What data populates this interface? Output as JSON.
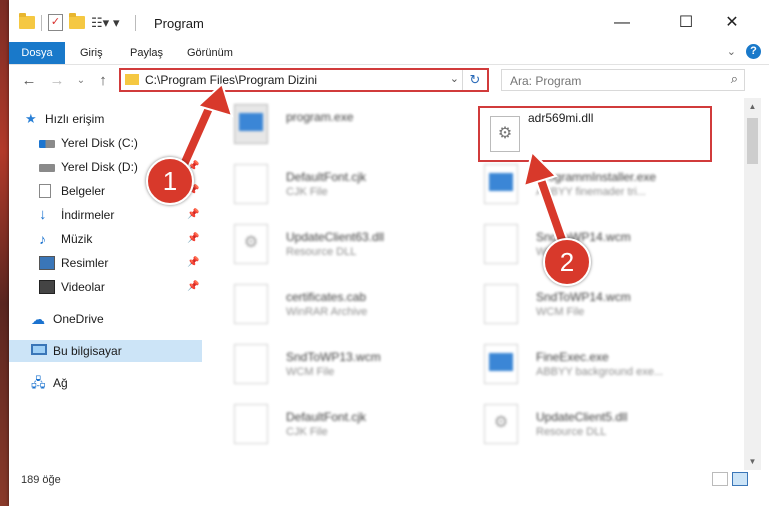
{
  "window": {
    "title": "Program",
    "controls": {
      "minimize": "—",
      "maximize": "☐",
      "close": "✕"
    }
  },
  "ribbon": {
    "tabs": [
      {
        "label": "Dosya"
      },
      {
        "label": "Giriş"
      },
      {
        "label": "Paylaş"
      },
      {
        "label": "Görünüm"
      }
    ],
    "help": "?"
  },
  "navigation": {
    "address_path": "C:\\Program Files\\Program Dizini",
    "search_placeholder": "Ara: Program"
  },
  "sidebar": {
    "items": [
      {
        "label": "Hızlı erişim",
        "icon": "star-icon"
      },
      {
        "label": "Yerel Disk (C:)",
        "icon": "disk-icon",
        "pinned": true
      },
      {
        "label": "Yerel Disk (D:)",
        "icon": "disk-icon",
        "pinned": true
      },
      {
        "label": "Belgeler",
        "icon": "documents-icon",
        "pinned": true
      },
      {
        "label": "İndirmeler",
        "icon": "downloads-icon",
        "pinned": true
      },
      {
        "label": "Müzik",
        "icon": "music-icon",
        "pinned": true
      },
      {
        "label": "Resimler",
        "icon": "pictures-icon",
        "pinned": true
      },
      {
        "label": "Videolar",
        "icon": "videos-icon",
        "pinned": true
      },
      {
        "label": "OneDrive",
        "icon": "cloud-icon"
      },
      {
        "label": "Bu bilgisayar",
        "icon": "computer-icon",
        "selected": true
      },
      {
        "label": "Ağ",
        "icon": "network-icon"
      }
    ]
  },
  "files": {
    "highlighted": {
      "name": "adr569mi.dll"
    },
    "left_column": [
      {
        "name": "program.exe",
        "sub": "",
        "icon": "exe"
      },
      {
        "name": "DefaultFont.cjk",
        "sub": "CJK File",
        "icon": "doc"
      },
      {
        "name": "UpdateClient63.dll",
        "sub": "Resource DLL",
        "icon": "gear"
      },
      {
        "name": "certificates.cab",
        "sub": "WinRAR Archive",
        "icon": "rar"
      },
      {
        "name": "SndToWP13.wcm",
        "sub": "WCM File",
        "icon": "doc"
      },
      {
        "name": "DefaultFont.cjk",
        "sub": "CJK File",
        "icon": "doc"
      }
    ],
    "right_column": [
      {
        "name": "ProgrammInstaller.exe",
        "sub": "ABBYY finemader tri...",
        "icon": "exe"
      },
      {
        "name": "SndToWP14.wcm",
        "sub": "WCM File",
        "icon": "doc"
      },
      {
        "name": "SndToWP14.wcm",
        "sub": "WCM File",
        "icon": "doc"
      },
      {
        "name": "FineExec.exe",
        "sub": "ABBYY background exe...",
        "icon": "exe"
      },
      {
        "name": "UpdateClient5.dll",
        "sub": "Resource DLL",
        "icon": "gear"
      }
    ]
  },
  "status": {
    "item_count": "189 öğe"
  },
  "annotations": [
    {
      "label": "1",
      "color": "#d8392b"
    },
    {
      "label": "2",
      "color": "#d8392b"
    }
  ],
  "colors": {
    "accent": "#1979ca",
    "highlight": "#d13b3b",
    "selected": "#cce4f7"
  }
}
